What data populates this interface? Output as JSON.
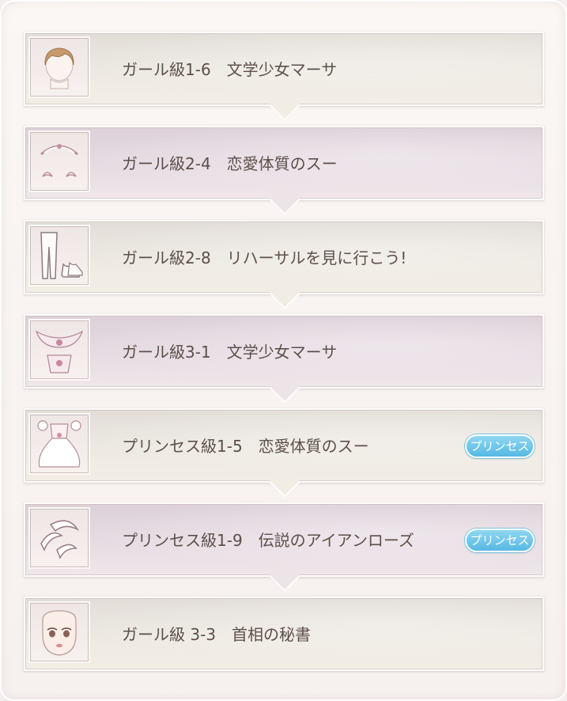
{
  "stages": [
    {
      "label": "ガール級1-6　文学少女マーサ",
      "icon": "hair-icon",
      "theme": "tan",
      "badge": ""
    },
    {
      "label": "ガール級2-4　恋愛体質のスー",
      "icon": "hair-accessory-icon",
      "theme": "lilac",
      "badge": ""
    },
    {
      "label": "ガール級2-8　リハーサルを見に行こう!",
      "icon": "tights-shoes-icon",
      "theme": "tan",
      "badge": ""
    },
    {
      "label": "ガール級3-1　文学少女マーサ",
      "icon": "lace-accessory-icon",
      "theme": "lilac",
      "badge": ""
    },
    {
      "label": "プリンセス級1-5　恋愛体質のスー",
      "icon": "dress-icon",
      "theme": "tan",
      "badge": "プリンセス"
    },
    {
      "label": "プリンセス級1-9　伝説のアイアンローズ",
      "icon": "feather-accessory-icon",
      "theme": "lilac",
      "badge": "プリンセス"
    },
    {
      "label": "ガール級 3-3　首相の秘書",
      "icon": "face-makeup-icon",
      "theme": "tan",
      "badge": ""
    }
  ]
}
